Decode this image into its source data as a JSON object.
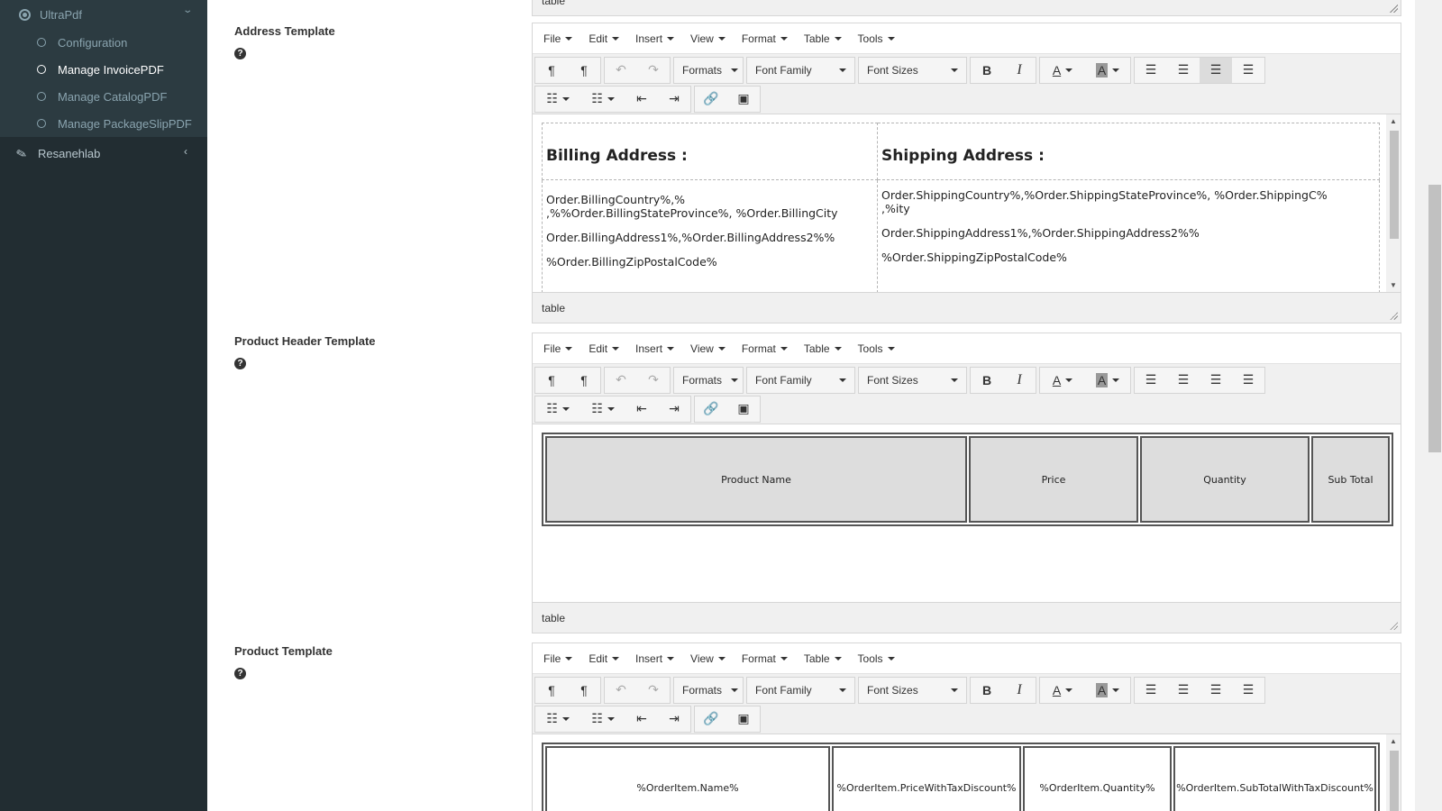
{
  "sidebar": {
    "parent": {
      "label": "UltraPdf"
    },
    "submenu": [
      {
        "label": "Configuration",
        "active": false
      },
      {
        "label": "Manage InvoicePDF",
        "active": true
      },
      {
        "label": "Manage CatalogPDF",
        "active": false
      },
      {
        "label": "Manage PackageSlipPDF",
        "active": false
      }
    ],
    "item": {
      "label": "Resanehlab"
    }
  },
  "top_partial_status": "table",
  "editor_menu": [
    "File",
    "Edit",
    "Insert",
    "View",
    "Format",
    "Table",
    "Tools"
  ],
  "editor_toolbar": {
    "formats": "Formats",
    "font_family": "Font Family",
    "font_sizes": "Font Sizes"
  },
  "sections": [
    {
      "label": "Address Template",
      "status": "table",
      "billing_heading": "Billing Address :",
      "shipping_heading": "Shipping Address :",
      "billing_lines": [
        "Order.BillingCountry%,%",
        ",%%Order.BillingStateProvince%, %Order.BillingCity",
        "Order.BillingAddress1%,%Order.BillingAddress2%%",
        "%Order.BillingZipPostalCode%"
      ],
      "shipping_lines": [
        "Order.ShippingCountry%,%Order.ShippingStateProvince%, %Order.ShippingC%",
        ",%ity",
        "Order.ShippingAddress1%,%Order.ShippingAddress2%%",
        "%Order.ShippingZipPostalCode%"
      ]
    },
    {
      "label": "Product Header Template",
      "status": "table",
      "columns": [
        "Product Name",
        "Price",
        "Quantity",
        "Sub Total"
      ]
    },
    {
      "label": "Product Template",
      "columns": [
        "%OrderItem.Name%",
        "%OrderItem.PriceWithTaxDiscount%",
        "%OrderItem.Quantity%",
        "%OrderItem.SubTotalWithTaxDiscount%"
      ]
    }
  ]
}
